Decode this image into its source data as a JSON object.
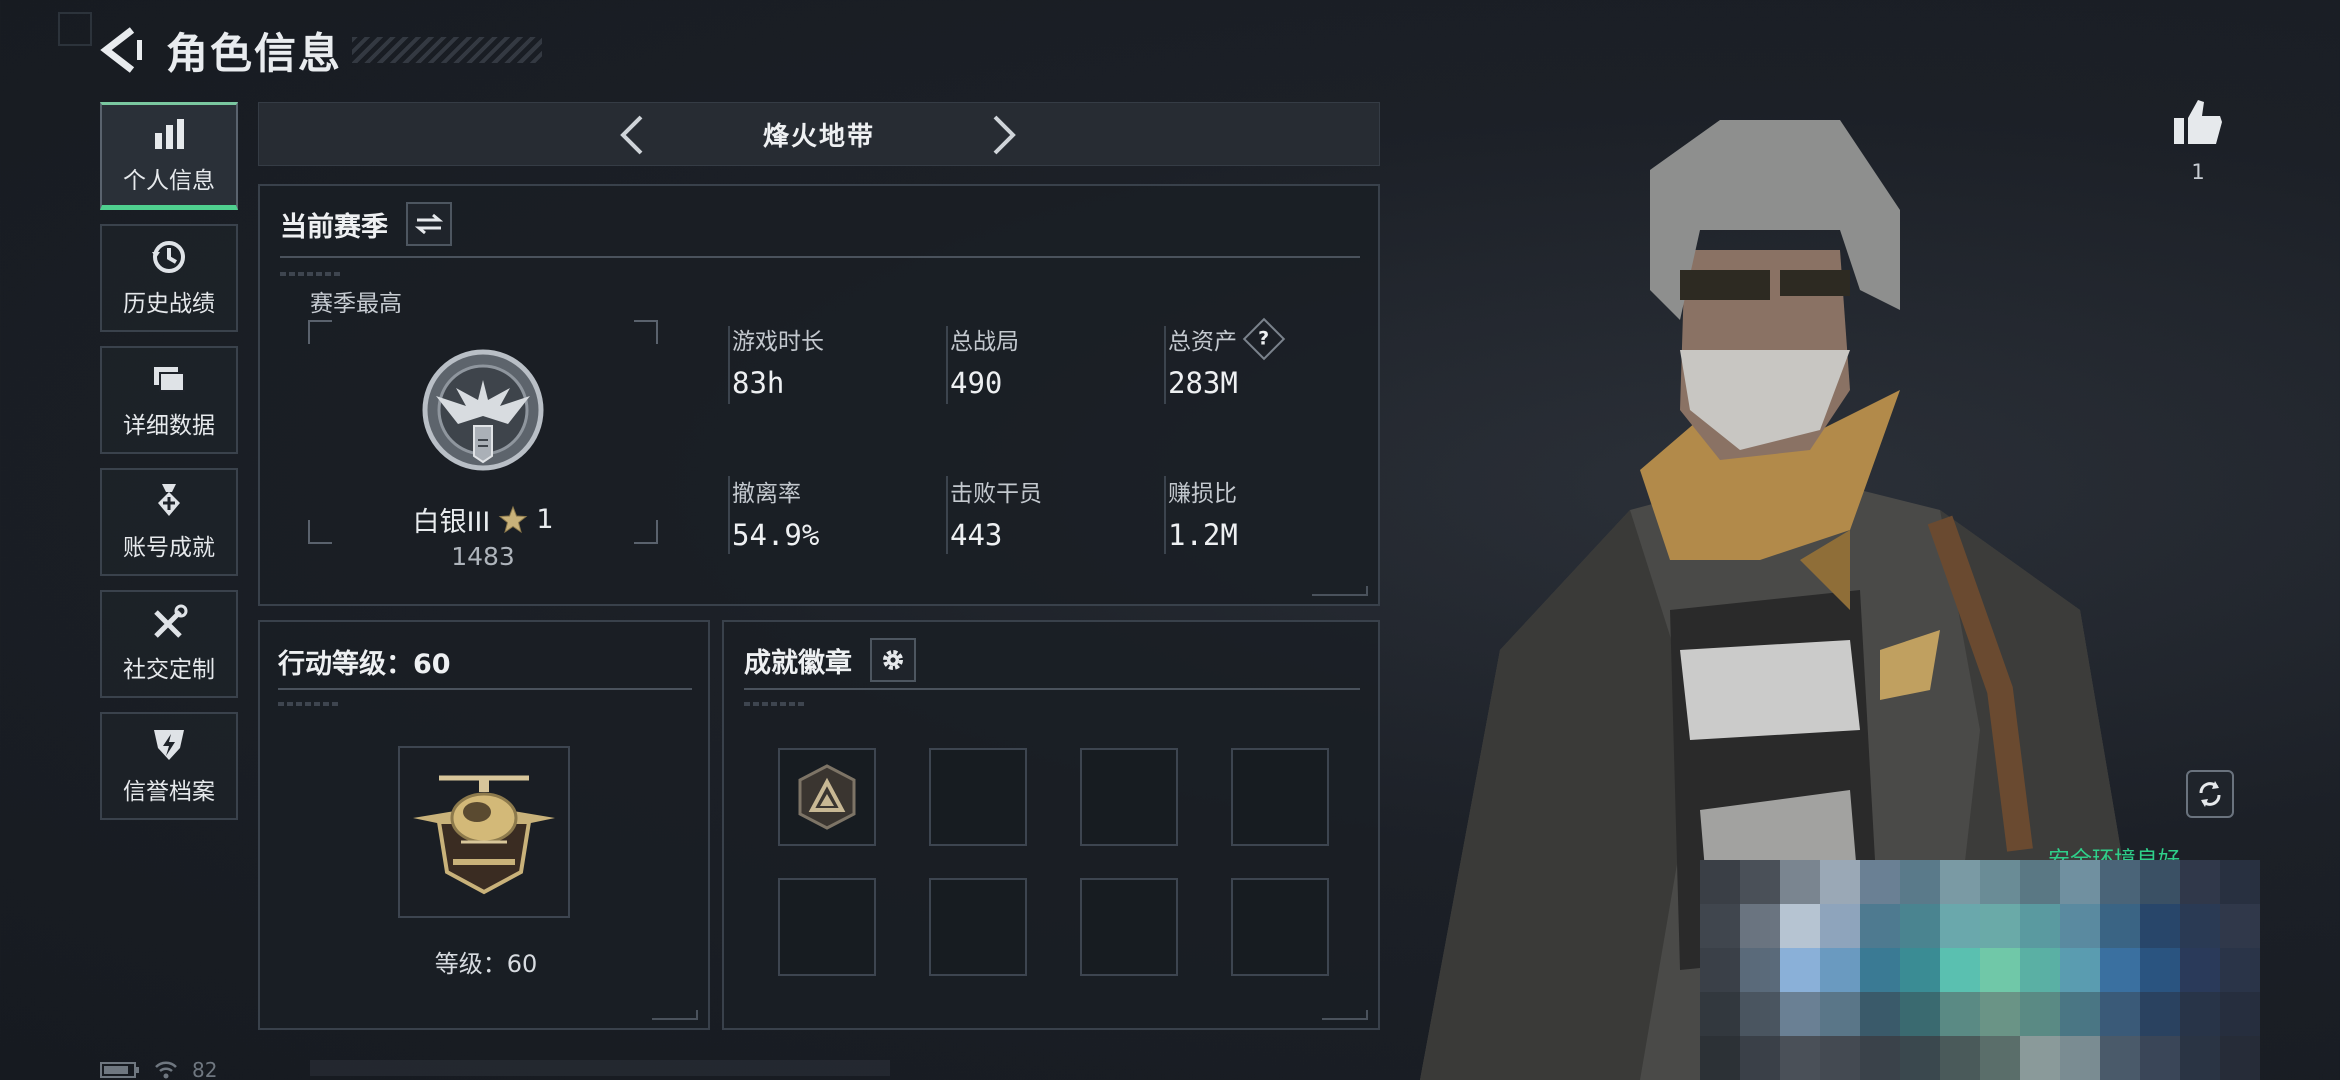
{
  "header": {
    "title": "角色信息"
  },
  "sidebar": {
    "items": [
      {
        "label": "个人信息",
        "icon": "bar-chart-icon",
        "active": true
      },
      {
        "label": "历史战绩",
        "icon": "history-clock-icon",
        "active": false
      },
      {
        "label": "详细数据",
        "icon": "folder-icon",
        "active": false
      },
      {
        "label": "账号成就",
        "icon": "medal-icon",
        "active": false
      },
      {
        "label": "社交定制",
        "icon": "wrench-tools-icon",
        "active": false
      },
      {
        "label": "信誉档案",
        "icon": "shield-bolt-icon",
        "active": false
      }
    ]
  },
  "mode_selector": {
    "label": "烽火地带"
  },
  "season": {
    "title": "当前赛季",
    "best_label": "赛季最高",
    "rank_name": "白银III",
    "rank_stars": "1",
    "rank_score": "1483",
    "stats": [
      {
        "label": "游戏时长",
        "value": "83h"
      },
      {
        "label": "总战局",
        "value": "490"
      },
      {
        "label": "总资产",
        "value": "283M",
        "help": "?"
      },
      {
        "label": "撤离率",
        "value": "54.9%"
      },
      {
        "label": "击败干员",
        "value": "443"
      },
      {
        "label": "赚损比",
        "value": "1.2M"
      }
    ]
  },
  "action_level": {
    "title": "行动等级：60",
    "level_text": "等级：60"
  },
  "badges": {
    "title": "成就徽章"
  },
  "likes": {
    "count": "1"
  },
  "safe_env": {
    "text": "安全环境良好"
  },
  "status_bar": {
    "battery_text": "82"
  },
  "colors": {
    "accent_green": "#4fd08f",
    "panel_border": "#39414b",
    "bg": "#1c2027"
  }
}
